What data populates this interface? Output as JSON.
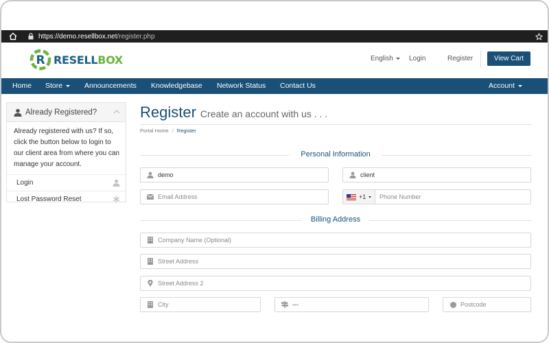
{
  "browser": {
    "url_host": "https://demo.resellbox.net",
    "url_path": "/register.php"
  },
  "brand": {
    "name_part1": "RESELL",
    "name_part2": "BOX",
    "color_primary": "#1a5077",
    "color_accent": "#6db33f"
  },
  "header": {
    "language": "English",
    "login": "Login",
    "register": "Register",
    "view_cart": "View Cart"
  },
  "nav": {
    "home": "Home",
    "store": "Store",
    "announcements": "Announcements",
    "knowledgebase": "Knowledgebase",
    "network_status": "Network Status",
    "contact_us": "Contact Us",
    "account": "Account"
  },
  "sidebar": {
    "title": "Already Registered?",
    "body": "Already registered with us? If so, click the button below to login to our client area from where you can manage your account.",
    "items": [
      {
        "label": "Login",
        "icon": "user-icon"
      },
      {
        "label": "Lost Password Reset",
        "icon": "asterisk-icon"
      }
    ]
  },
  "page": {
    "title": "Register",
    "subtitle": "Create an account with us . . .",
    "breadcrumb": [
      "Portal Home",
      "Register"
    ]
  },
  "personal": {
    "heading": "Personal Information",
    "first_name": "demo",
    "last_name": "client",
    "email_placeholder": "Email Address",
    "phone_country_code": "+1",
    "phone_placeholder": "Phone Number"
  },
  "billing": {
    "heading": "Billing Address",
    "company_placeholder": "Company Name (Optional)",
    "street_placeholder": "Street Address",
    "street2_placeholder": "Street Address 2",
    "city_placeholder": "City",
    "state_value": "---",
    "postcode_placeholder": "Postcode"
  }
}
